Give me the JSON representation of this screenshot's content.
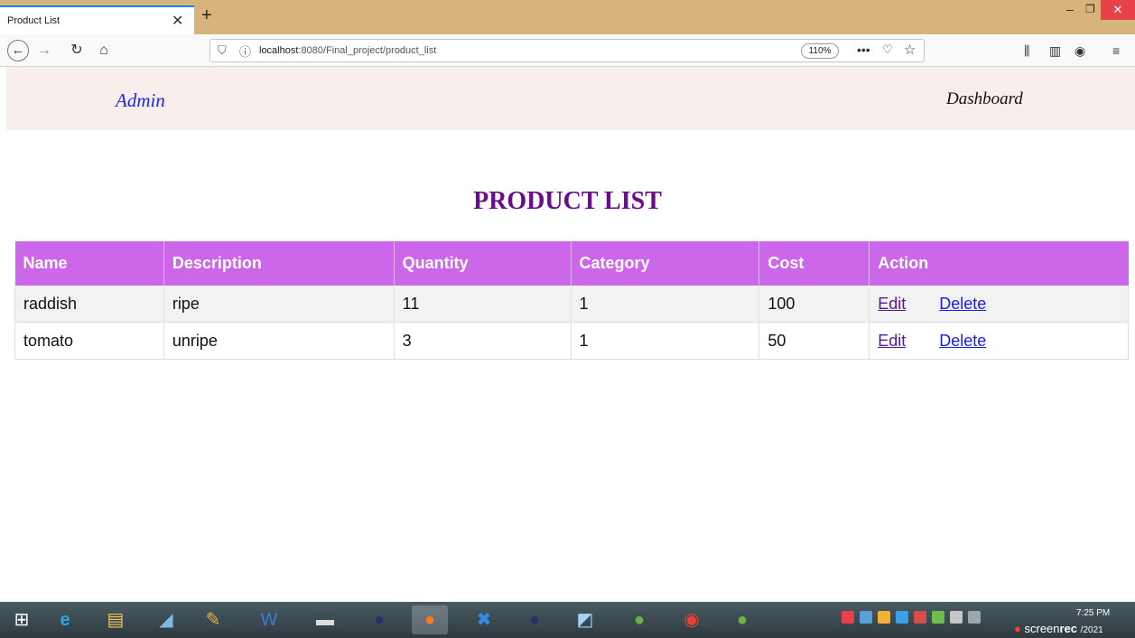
{
  "browser": {
    "tab_title": "Product List",
    "url_host": "localhost",
    "url_rest": ":8080/Final_project/product_list",
    "zoom": "110%"
  },
  "header": {
    "left_link": "Admin",
    "right_link": "Dashboard"
  },
  "page": {
    "title": "PRODUCT LIST"
  },
  "table": {
    "columns": [
      "Name",
      "Description",
      "Quantity",
      "Category",
      "Cost",
      "Action"
    ],
    "rows": [
      {
        "name": "raddish",
        "description": "ripe",
        "quantity": "11",
        "category": "1",
        "cost": "100",
        "edit": "Edit",
        "delete": "Delete"
      },
      {
        "name": "tomato",
        "description": "unripe",
        "quantity": "3",
        "category": "1",
        "cost": "50",
        "edit": "Edit",
        "delete": "Delete"
      }
    ]
  },
  "taskbar": {
    "clock_time": "7:25 PM",
    "clock_date_partial": "/2021",
    "watermark_prefix": "screen",
    "watermark_suffix": "rec"
  },
  "colors": {
    "table_header_bg": "#cb67e8",
    "title_color": "#6a0d8d",
    "header_bg": "#f8eeec",
    "admin_link_color": "#1f22ea",
    "tab_strip_bg": "#d7b47c"
  }
}
